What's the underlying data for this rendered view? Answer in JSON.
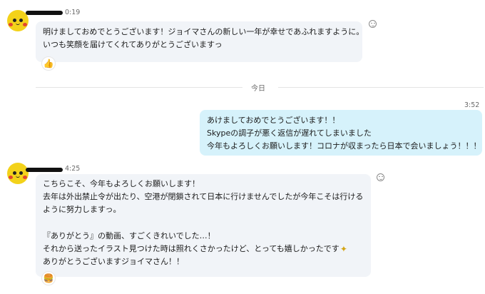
{
  "messages": [
    {
      "time": "0:19",
      "lines": [
        "明けましておめでとうございます！ジョイマさんの新しい一年が幸せであふれますように。",
        "いつも笑顔を届けてくれてありがとうございますっ"
      ],
      "reaction_icon": "thumbs-up"
    },
    {
      "time": "3:52",
      "lines": [
        "あけましておめでとうございます！！",
        "Skypeの調子が悪く返信が遅れてしまいました",
        "今年もよろしくお願いします！コロナが収まったら日本で会いましょう！！！"
      ]
    },
    {
      "time": "4:25",
      "lines": [
        "こちらこそ、今年もよろしくお願いします！",
        "去年は外出禁止令が出たり、空港が閉鎖されて日本に行けませんでしたが今年こそは行ける",
        "ように努力しますっ。",
        "",
        "『ありがとう』の動画、すごくきれいでした…！",
        "それから送ったイラスト見つけた時は照れくさかったけど、とっても嬉しかったです",
        "ありがとうございますジョイマさん！！"
      ],
      "inline_icon": "sparkle",
      "reaction_icon": "burger"
    }
  ],
  "divider_label": "今日",
  "colors": {
    "incoming_bubble": "#f1f4f8",
    "outgoing_bubble": "#d6f2fb",
    "avatar": "#f3d21a"
  }
}
